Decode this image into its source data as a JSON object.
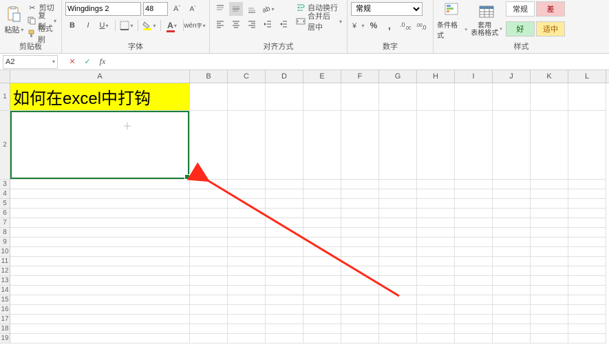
{
  "ribbon": {
    "clipboard": {
      "paste": "粘贴",
      "cut": "剪切",
      "copy": "复制",
      "format_painter": "格式刷",
      "label": "剪贴板"
    },
    "font": {
      "name": "Wingdings 2",
      "size": "48",
      "label": "字体"
    },
    "alignment": {
      "wrap": "自动换行",
      "merge": "合并后居中",
      "label": "对齐方式"
    },
    "number": {
      "format": "常规",
      "label": "数字"
    },
    "styles": {
      "conditional": "条件格式",
      "table": "套用\n表格格式",
      "normal": "常规",
      "bad": "差",
      "good": "好",
      "neutral": "适中",
      "label": "样式"
    }
  },
  "namebox": "A2",
  "formula": "",
  "columns": [
    "A",
    "B",
    "C",
    "D",
    "E",
    "F",
    "G",
    "H",
    "I",
    "J",
    "K",
    "L"
  ],
  "col_widths": {
    "A": 261,
    "other": 55
  },
  "cells": {
    "A1": {
      "value": "如何在excel中打钩",
      "bg": "#ffff00",
      "size": 24
    }
  },
  "selected_cell": "A2",
  "row_heights": {
    "1": 40,
    "2": 100,
    "rest": 14
  }
}
